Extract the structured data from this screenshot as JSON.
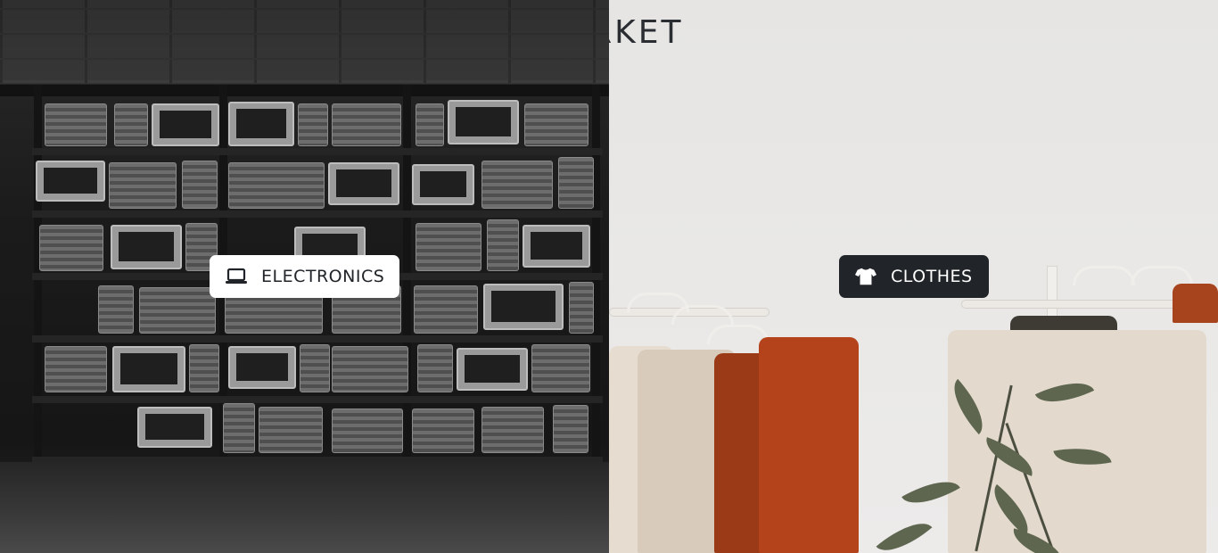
{
  "header": {
    "brand_title": "MARKET"
  },
  "categories": [
    {
      "label": "ELECTRONICS",
      "icon": "laptop-icon",
      "style": "light"
    },
    {
      "label": "CLOTHES",
      "icon": "shirt-icon",
      "style": "dark"
    }
  ],
  "colors": {
    "button_light_bg": "#ffffff",
    "button_dark_bg": "#212529",
    "title_text": "#2a2d31"
  }
}
